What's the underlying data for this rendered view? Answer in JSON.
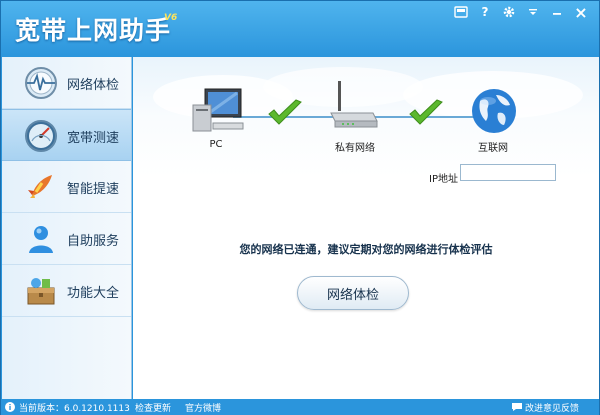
{
  "app": {
    "title": "宽带上网助手",
    "version": "V6"
  },
  "window_controls": [
    {
      "name": "skin-icon"
    },
    {
      "name": "help-icon",
      "glyph": "?"
    },
    {
      "name": "gear-icon"
    },
    {
      "name": "menu-icon"
    },
    {
      "name": "minimize-icon"
    },
    {
      "name": "close-icon",
      "glyph": "×"
    }
  ],
  "sidebar": {
    "items": [
      {
        "label": "网络体检",
        "icon": "heartbeat-globe-icon"
      },
      {
        "label": "宽带测速",
        "icon": "speedometer-icon",
        "active": true
      },
      {
        "label": "智能提速",
        "icon": "rocket-icon"
      },
      {
        "label": "自助服务",
        "icon": "user-icon"
      },
      {
        "label": "功能大全",
        "icon": "toolbox-icon"
      }
    ]
  },
  "main": {
    "nodes": [
      {
        "label": "PC",
        "icon": "pc-icon"
      },
      {
        "label": "私有网络",
        "icon": "router-icon"
      },
      {
        "label": "互联网",
        "icon": "globe-icon"
      }
    ],
    "ip_label": "IP地址",
    "ip_value": "",
    "status_message": "您的网络已连通，建议定期对您的网络进行体检评估",
    "check_button": "网络体检"
  },
  "statusbar": {
    "version_text": "当前版本：6.0.1210.1113",
    "update_link": "检查更新",
    "weibo_link": "官方微博",
    "feedback_link": "改进意见反馈"
  },
  "colors": {
    "accent": "#2b95dc",
    "check_green": "#5cb82e"
  }
}
